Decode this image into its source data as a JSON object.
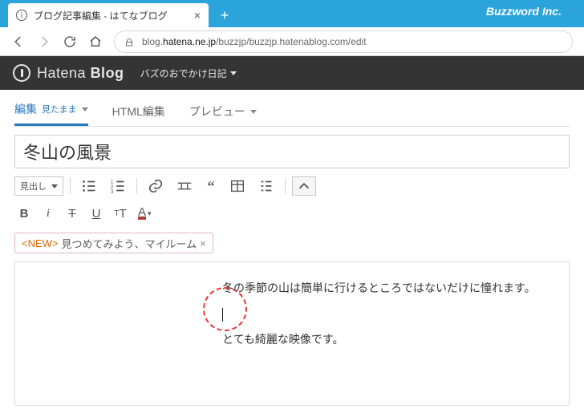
{
  "titlebar": {
    "brand": "Buzzword Inc."
  },
  "tab": {
    "title": "ブログ記事編集 - はてなブログ"
  },
  "address": {
    "pre": "blog.",
    "host": "hatena.ne.jp",
    "path": "/buzzjp/buzzjp.hatenablog.com/edit"
  },
  "hatena": {
    "logo_a": "Hatena",
    "logo_b": "Blog",
    "blog_name": "バズのおでかけ日記"
  },
  "modeTabs": {
    "edit": "編集",
    "edit_sub": "見たまま",
    "html": "HTML編集",
    "preview": "プレビュー"
  },
  "post": {
    "title": "冬山の風景"
  },
  "toolbar": {
    "heading_select": "見出し"
  },
  "topicChip": {
    "new": "<NEW>",
    "text": "見つめてみよう、マイルーム",
    "close": "×"
  },
  "body": {
    "p1": "冬の季節の山は簡単に行けるところではないだけに憧れます。",
    "p3": "とても綺麗な映像です。"
  }
}
